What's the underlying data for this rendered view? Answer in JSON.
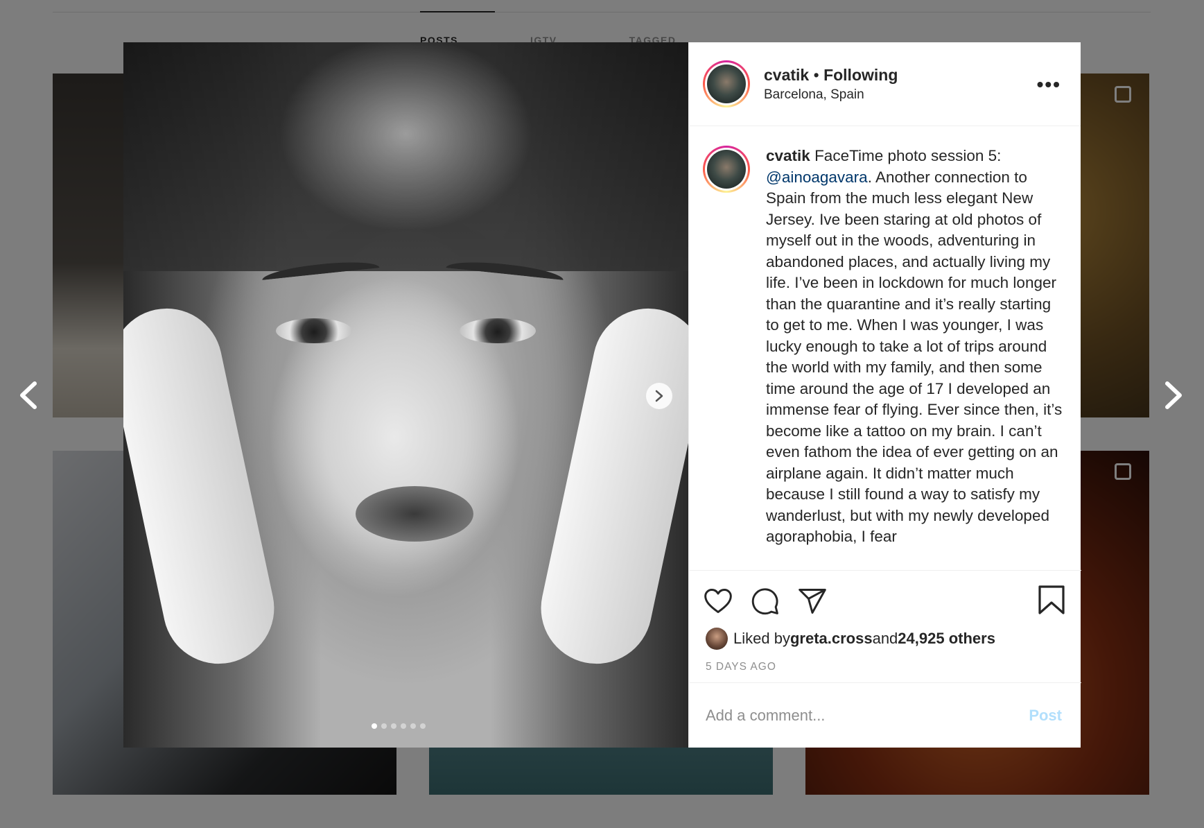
{
  "background": {
    "tabs": [
      "POSTS",
      "IGTV",
      "TAGGED"
    ]
  },
  "post": {
    "username": "cvatik",
    "separator": "•",
    "follow_status": "Following",
    "location": "Barcelona, Spain",
    "more_label": "•••",
    "caption": {
      "username": "cvatik",
      "text_before": " FaceTime photo session 5: ",
      "mention": "@ainoagavara",
      "text_after": ". Another connection to Spain from the much less elegant New Jersey. Ive been staring at old photos of myself out in the woods, adventuring in abandoned places, and actually living my life. I’ve been in lockdown for much longer than the quarantine and it’s really starting to get to me. When I was younger, I was lucky enough to take a lot of trips around the world with my family, and then some time around the age of 17 I developed an immense fear of flying. Ever since then, it’s become like a tattoo on my brain. I can’t even fathom the idea of ever getting on an airplane again. It didn’t matter much because I still found a way to satisfy my wanderlust, but with my newly developed agoraphobia, I fear"
    },
    "likes": {
      "prefix": "Liked by ",
      "user": "greta.cross",
      "middle": " and ",
      "others": "24,925 others"
    },
    "timestamp": "5 DAYS AGO",
    "comment": {
      "placeholder": "Add a comment...",
      "post_label": "Post"
    },
    "carousel": {
      "total": 6,
      "active_index": 0
    }
  },
  "icons": {
    "like": "heart-icon",
    "comment": "comment-icon",
    "share": "share-icon",
    "save": "bookmark-icon",
    "prev": "chevron-left-icon",
    "next": "chevron-right-icon"
  },
  "colors": {
    "mention": "#00376b",
    "post_button": "#b2dffc",
    "muted_text": "#8e8e8e"
  }
}
